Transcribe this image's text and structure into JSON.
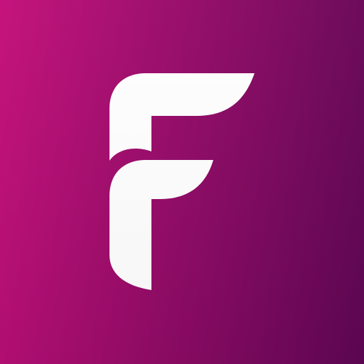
{
  "app_icon": {
    "logo": {
      "icon": "letter-f-logo-icon",
      "lettering": "F"
    },
    "colors": {
      "gradient_start": "#c4107a",
      "gradient_end": "#5e0653",
      "glyph": "#ffffff"
    }
  }
}
